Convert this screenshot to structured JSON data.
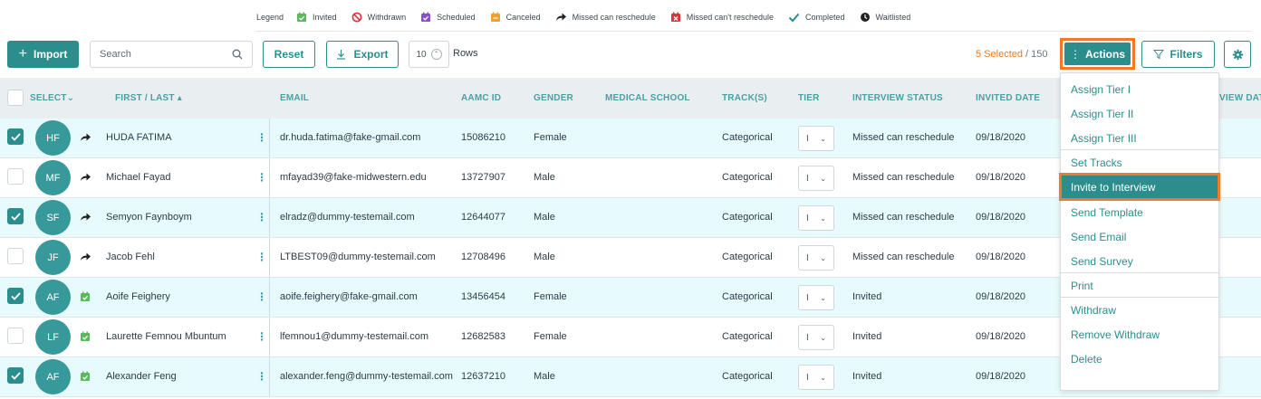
{
  "legend": {
    "title": "Legend",
    "items": [
      {
        "label": "Invited",
        "icon": "calendar-check-icon",
        "color": "#5cb85c"
      },
      {
        "label": "Withdrawn",
        "icon": "ban-icon",
        "color": "#d9343a"
      },
      {
        "label": "Scheduled",
        "icon": "calendar-check-icon",
        "color": "#8a4fd1"
      },
      {
        "label": "Canceled",
        "icon": "calendar-minus-icon",
        "color": "#f0a030"
      },
      {
        "label": "Missed can reschedule",
        "icon": "share-arrow-icon",
        "color": "#222222"
      },
      {
        "label": "Missed can't reschedule",
        "icon": "calendar-x-icon",
        "color": "#d9343a"
      },
      {
        "label": "Completed",
        "icon": "check-icon",
        "color": "#2b8e8d"
      },
      {
        "label": "Waitlisted",
        "icon": "clock-icon",
        "color": "#222222"
      }
    ]
  },
  "toolbar": {
    "import_label": "Import",
    "search_placeholder": "Search",
    "reset_label": "Reset",
    "export_label": "Export",
    "rows_value": "10",
    "rows_label": "Rows",
    "selected_count": "5 Selected",
    "selected_total": " / 150",
    "actions_label": "Actions",
    "filters_label": "Filters"
  },
  "table": {
    "columns": {
      "select": "SELECT",
      "name": "FIRST / LAST",
      "email": "EMAIL",
      "aamc": "AAMC ID",
      "gender": "GENDER",
      "school": "MEDICAL SCHOOL",
      "track": "TRACK(S)",
      "tier": "TIER",
      "status": "INTERVIEW STATUS",
      "invited": "INVITED DATE",
      "interview_cut": "VIEW DAT"
    },
    "rows": [
      {
        "selected": true,
        "initials": "HF",
        "status_icon": "share-arrow-icon",
        "name": "HUDA FATIMA",
        "email": "dr.huda.fatima@fake-gmail.com",
        "aamc": "15086210",
        "gender": "Female",
        "track": "Categorical",
        "tier": "I",
        "status": "Missed can reschedule",
        "invited": "09/18/2020"
      },
      {
        "selected": false,
        "initials": "MF",
        "status_icon": "share-arrow-icon",
        "name": "Michael Fayad",
        "email": "mfayad39@fake-midwestern.edu",
        "aamc": "13727907",
        "gender": "Male",
        "track": "Categorical",
        "tier": "I",
        "status": "Missed can reschedule",
        "invited": "09/18/2020"
      },
      {
        "selected": true,
        "initials": "SF",
        "status_icon": "share-arrow-icon",
        "name": "Semyon Faynboym",
        "email": "elradz@dummy-testemail.com",
        "aamc": "12644077",
        "gender": "Male",
        "track": "Categorical",
        "tier": "I",
        "status": "Missed can reschedule",
        "invited": "09/18/2020"
      },
      {
        "selected": false,
        "initials": "JF",
        "status_icon": "share-arrow-icon",
        "name": "Jacob Fehl",
        "email": "LTBEST09@dummy-testemail.com",
        "aamc": "12708496",
        "gender": "Male",
        "track": "Categorical",
        "tier": "I",
        "status": "Missed can reschedule",
        "invited": "09/18/2020"
      },
      {
        "selected": true,
        "initials": "AF",
        "status_icon": "calendar-check-icon",
        "name": "Aoife Feighery",
        "email": "aoife.feighery@fake-gmail.com",
        "aamc": "13456454",
        "gender": "Female",
        "track": "Categorical",
        "tier": "I",
        "status": "Invited",
        "invited": "09/18/2020"
      },
      {
        "selected": false,
        "initials": "LF",
        "status_icon": "calendar-check-icon",
        "name": "Laurette Femnou Mbuntum",
        "email": "lfemnou1@dummy-testemail.com",
        "aamc": "12682583",
        "gender": "Female",
        "track": "Categorical",
        "tier": "I",
        "status": "Invited",
        "invited": "09/18/2020"
      },
      {
        "selected": true,
        "initials": "AF",
        "status_icon": "calendar-check-icon",
        "name": "Alexander Feng",
        "email": "alexander.feng@dummy-testemail.com",
        "aamc": "12637210",
        "gender": "Male",
        "track": "Categorical",
        "tier": "I",
        "status": "Invited",
        "invited": "09/18/2020"
      }
    ]
  },
  "actions_menu": {
    "items": [
      "Assign Tier I",
      "Assign Tier II",
      "Assign Tier III",
      "Set Tracks",
      "Invite to Interview",
      "Send Template",
      "Send Email",
      "Send Survey",
      "Print",
      "Withdraw",
      "Remove Withdraw",
      "Delete"
    ],
    "highlighted": "Invite to Interview"
  },
  "colors": {
    "accent": "#2b8e8d",
    "highlight_frame": "#ee7b2c",
    "selected_row": "#e8fbfc"
  }
}
